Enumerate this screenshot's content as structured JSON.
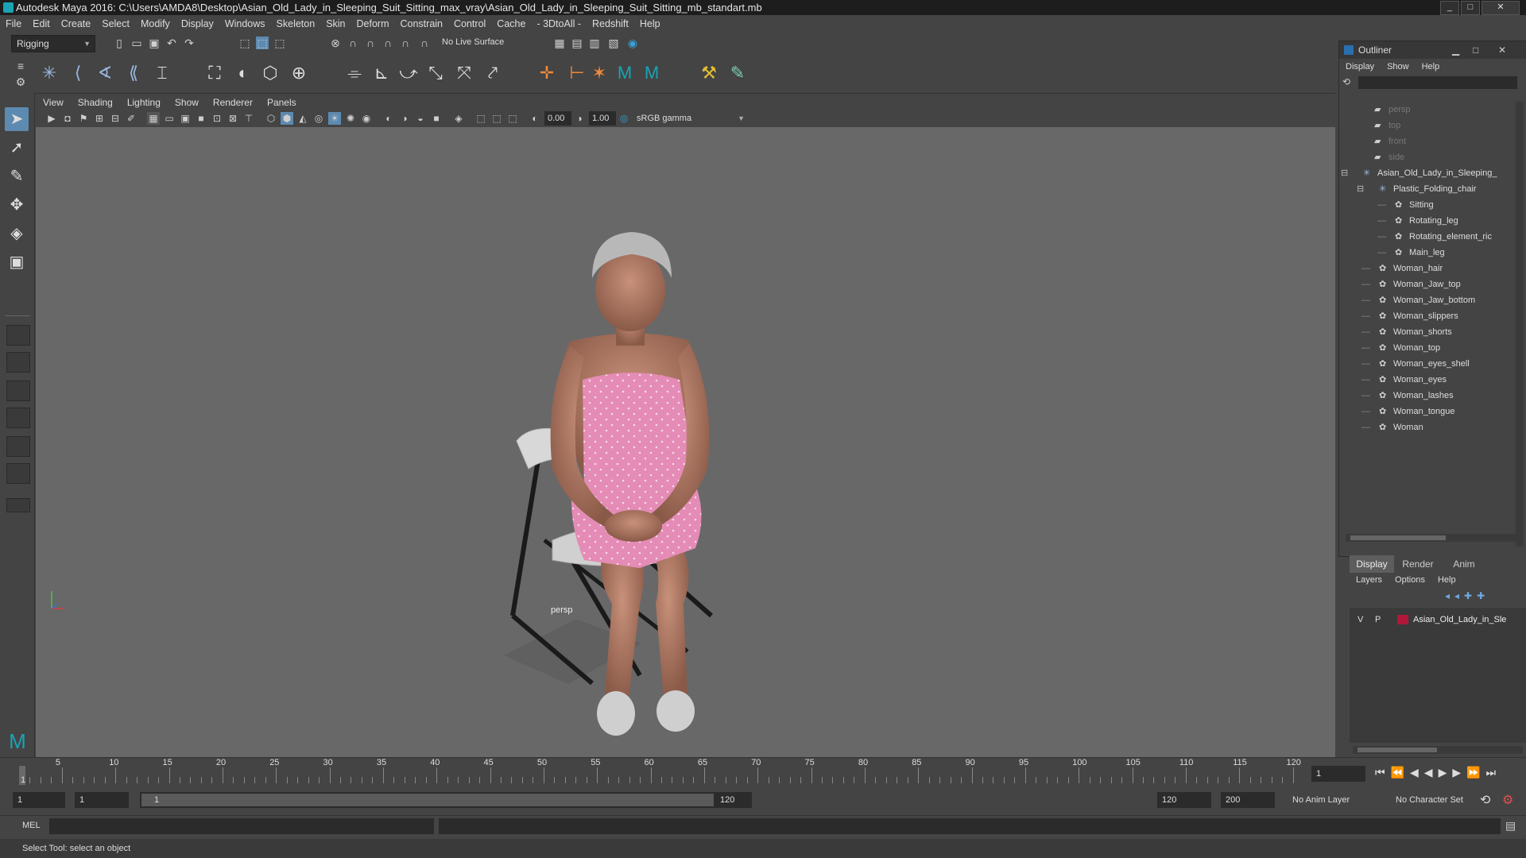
{
  "window": {
    "title": "Autodesk Maya 2016: C:\\Users\\AMDA8\\Desktop\\Asian_Old_Lady_in_Sleeping_Suit_Sitting_max_vray\\Asian_Old_Lady_in_Sleeping_Suit_Sitting_mb_standart.mb"
  },
  "menubar": [
    "File",
    "Edit",
    "Create",
    "Select",
    "Modify",
    "Display",
    "Windows",
    "Skeleton",
    "Skin",
    "Deform",
    "Constrain",
    "Control",
    "Cache",
    "- 3DtoAll -",
    "Redshift",
    "Help"
  ],
  "statusline": {
    "mode": "Rigging",
    "live_surface": "No Live Surface"
  },
  "panel": {
    "menus": [
      "View",
      "Shading",
      "Lighting",
      "Show",
      "Renderer",
      "Panels"
    ],
    "exposure": "0.00",
    "gamma": "1.00",
    "color_space": "sRGB gamma",
    "camera_label": "persp"
  },
  "outliner": {
    "title": "Outliner",
    "menus": [
      "Display",
      "Show",
      "Help"
    ],
    "items": [
      {
        "label": "persp",
        "type": "camera",
        "dim": true
      },
      {
        "label": "top",
        "type": "camera",
        "dim": true
      },
      {
        "label": "front",
        "type": "camera",
        "dim": true
      },
      {
        "label": "side",
        "type": "camera",
        "dim": true
      },
      {
        "label": "Asian_Old_Lady_in_Sleeping_",
        "type": "group"
      },
      {
        "label": "Plastic_Folding_chair",
        "type": "group"
      },
      {
        "label": "Sitting",
        "type": "mesh"
      },
      {
        "label": "Rotating_leg",
        "type": "mesh"
      },
      {
        "label": "Rotating_element_ric",
        "type": "mesh"
      },
      {
        "label": "Main_leg",
        "type": "mesh"
      },
      {
        "label": "Woman_hair",
        "type": "mesh"
      },
      {
        "label": "Woman_Jaw_top",
        "type": "mesh"
      },
      {
        "label": "Woman_Jaw_bottom",
        "type": "mesh"
      },
      {
        "label": "Woman_slippers",
        "type": "mesh"
      },
      {
        "label": "Woman_shorts",
        "type": "mesh"
      },
      {
        "label": "Woman_top",
        "type": "mesh"
      },
      {
        "label": "Woman_eyes_shell",
        "type": "mesh"
      },
      {
        "label": "Woman_eyes",
        "type": "mesh"
      },
      {
        "label": "Woman_lashes",
        "type": "mesh"
      },
      {
        "label": "Woman_tongue",
        "type": "mesh"
      },
      {
        "label": "Woman",
        "type": "mesh"
      }
    ]
  },
  "layers": {
    "tabs": [
      "Display",
      "Render",
      "Anim"
    ],
    "menus": [
      "Layers",
      "Options",
      "Help"
    ],
    "row": {
      "v": "V",
      "p": "P",
      "name": "Asian_Old_Lady_in_Sle",
      "color": "#b0183a"
    }
  },
  "timeline": {
    "ticks": [
      "5",
      "10",
      "15",
      "20",
      "25",
      "30",
      "35",
      "40",
      "45",
      "50",
      "55",
      "60",
      "65",
      "70",
      "75",
      "80",
      "85",
      "90",
      "95",
      "100",
      "105",
      "110",
      "115",
      "120"
    ],
    "start_marker": "1",
    "current_frame": "1"
  },
  "range": {
    "start": "1",
    "playback_start": "1",
    "slider_start": "1",
    "slider_end": "120",
    "playback_end": "120",
    "end": "200",
    "anim_layer": "No Anim Layer",
    "character_set": "No Character Set"
  },
  "cmdline": {
    "label": "MEL"
  },
  "helpline": {
    "text": "Select Tool: select an object"
  },
  "colors": {
    "accent": "#5d8ab0",
    "layer_color": "#b0183a"
  }
}
